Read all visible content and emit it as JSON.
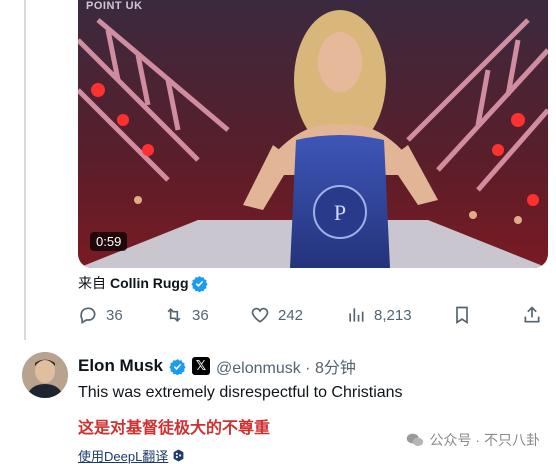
{
  "video": {
    "brand_overlay": "POINT UK",
    "duration": "0:59"
  },
  "source": {
    "prefix": "来自",
    "author_name": "Collin Rugg"
  },
  "actions": {
    "replies": "36",
    "reposts": "36",
    "likes": "242",
    "views": "8,213"
  },
  "reply": {
    "author_name": "Elon Musk",
    "x_badge": "𝕏",
    "handle_time": "@elonmusk · 8分钟",
    "text": "This was extremely disrespectful to Christians",
    "translated_text": "这是对基督徒极大的不尊重",
    "translate_link": "使用DeepL翻译"
  },
  "watermark": {
    "text": "公众号 · 不只八卦"
  },
  "colors": {
    "verified_blue": "#1d9bf0",
    "action_gray": "#536471",
    "translated_red": "#d13030"
  }
}
